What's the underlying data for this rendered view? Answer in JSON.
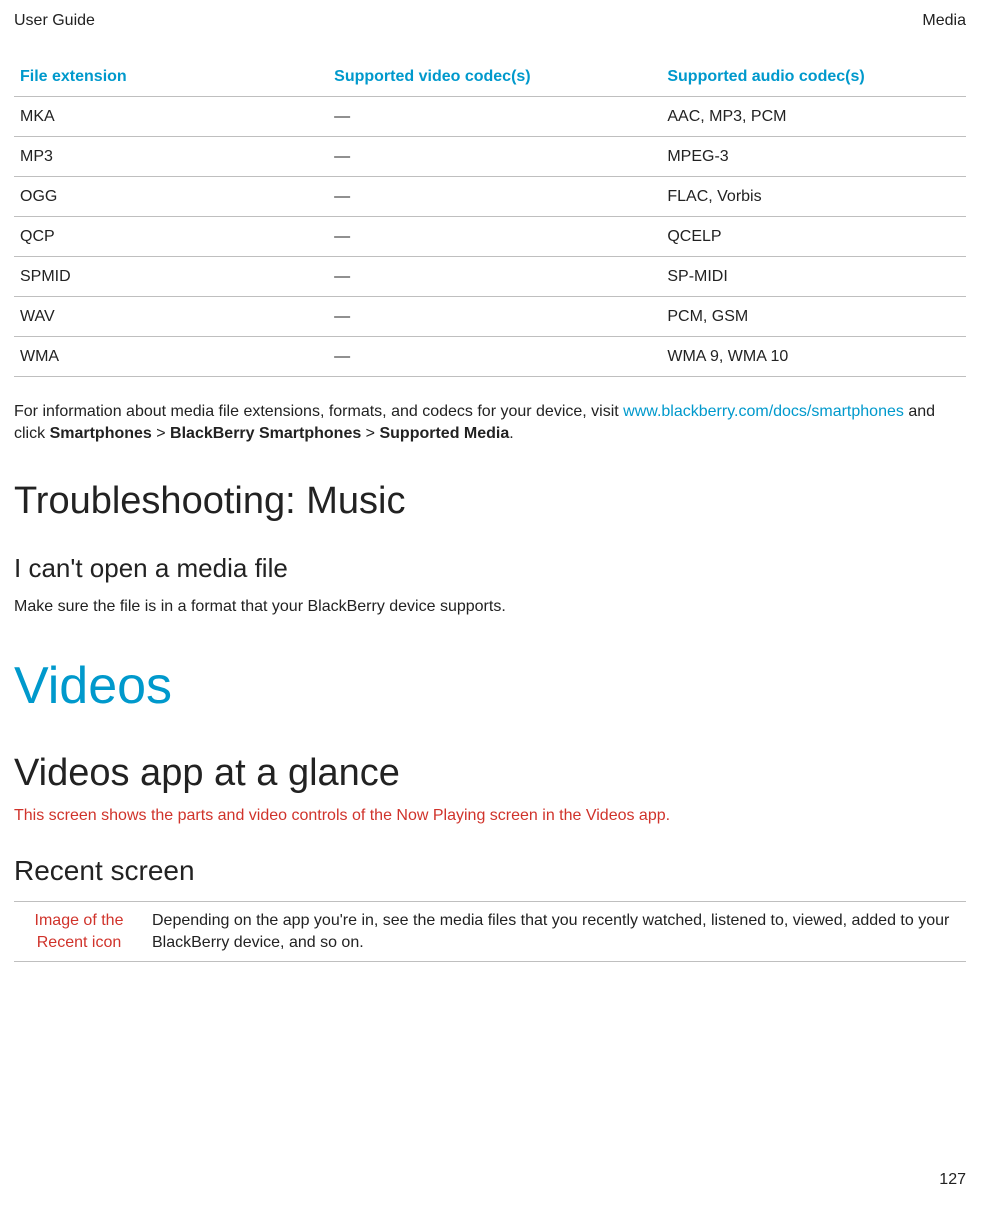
{
  "header": {
    "left": "User Guide",
    "right": "Media"
  },
  "codecs_table": {
    "headers": [
      "File extension",
      "Supported video codec(s)",
      "Supported audio codec(s)"
    ],
    "rows": [
      {
        "ext": "MKA",
        "video": "—",
        "audio": "AAC, MP3, PCM"
      },
      {
        "ext": "MP3",
        "video": "—",
        "audio": "MPEG-3"
      },
      {
        "ext": "OGG",
        "video": "—",
        "audio": "FLAC, Vorbis"
      },
      {
        "ext": "QCP",
        "video": "—",
        "audio": "QCELP"
      },
      {
        "ext": "SPMID",
        "video": "—",
        "audio": "SP-MIDI"
      },
      {
        "ext": "WAV",
        "video": "—",
        "audio": "PCM, GSM"
      },
      {
        "ext": "WMA",
        "video": "—",
        "audio": "WMA 9, WMA 10"
      }
    ]
  },
  "info": {
    "pre_link": "For information about media file extensions, formats, and codecs for your device, visit ",
    "link": "www.blackberry.com/docs/smartphones",
    "post_link_1": " and click ",
    "b1": "Smartphones",
    "sep1": " > ",
    "b2": "BlackBerry Smartphones",
    "sep2": " > ",
    "b3": "Supported Media",
    "period": "."
  },
  "troubleshooting": {
    "title": "Troubleshooting: Music",
    "sub": "I can't open a media file",
    "body": "Make sure the file is in a format that your BlackBerry device supports."
  },
  "videos": {
    "h1": "Videos",
    "glance": "Videos app at a glance",
    "redline": "This screen shows the parts and video controls of the Now Playing screen in the Videos app.",
    "recent_h": "Recent screen",
    "recent_icon": "Image of the Recent icon",
    "recent_text": "Depending on the app you're in, see the media files that you recently watched, listened to, viewed, added to your BlackBerry device, and so on."
  },
  "page_number": "127"
}
